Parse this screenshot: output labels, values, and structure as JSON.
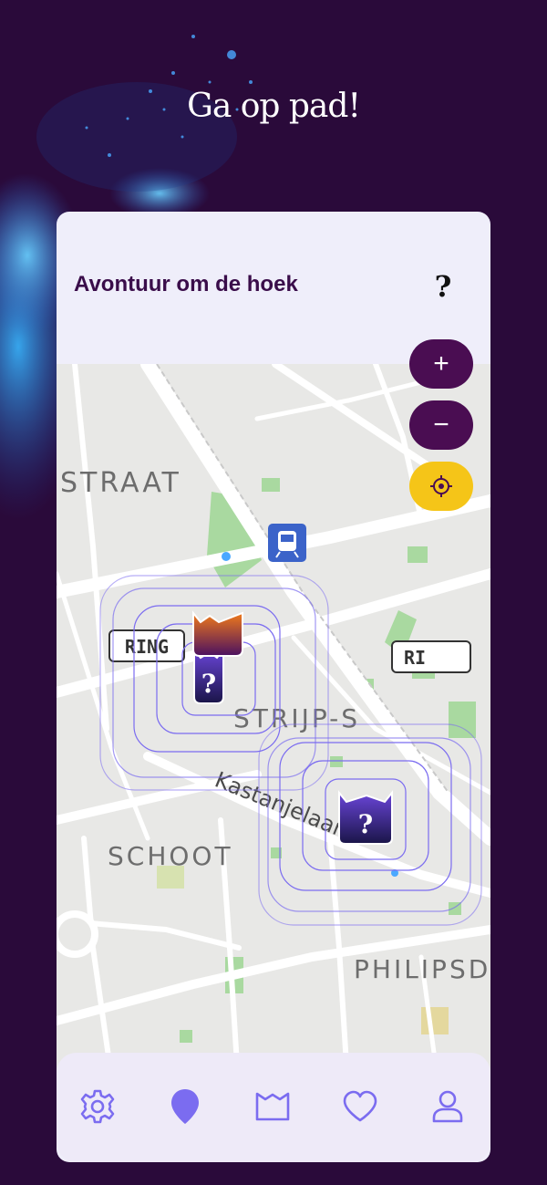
{
  "headline": "Ga op pad!",
  "card": {
    "title": "Avontuur om de hoek",
    "help_label": "?"
  },
  "map": {
    "labels": {
      "straat": "STRAAT",
      "ring_left": "RING",
      "ring_right": "RI",
      "strijp": "STRIJP-S",
      "kastanjelaan": "Kastanjelaan",
      "schoot": "SCHOOT",
      "philips": "PHILIPSD"
    },
    "markers": [
      {
        "kind": "unknown",
        "glyph": "?"
      },
      {
        "kind": "unknown",
        "glyph": "?"
      }
    ]
  },
  "controls": {
    "zoom_in": "+",
    "zoom_out": "−"
  },
  "nav": [
    {
      "icon": "gear-icon",
      "active": false
    },
    {
      "icon": "map-pin-icon",
      "active": true
    },
    {
      "icon": "book-icon",
      "active": false
    },
    {
      "icon": "heart-icon",
      "active": false
    },
    {
      "icon": "user-icon",
      "active": false
    }
  ],
  "colors": {
    "brand": "#4a0d52",
    "accent": "#7b6cf0",
    "locate": "#f5c518",
    "background": "#2a0a3a"
  }
}
